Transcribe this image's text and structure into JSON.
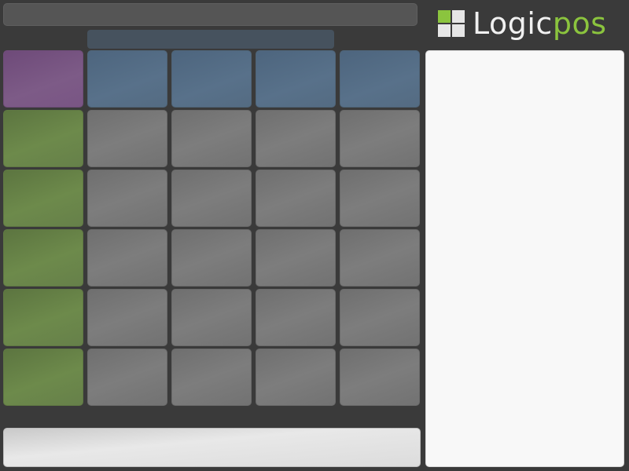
{
  "header": {
    "title": "",
    "subtitle": ""
  },
  "logo": {
    "text_part1": "Logic",
    "text_part2": "pos",
    "mark_icon": "logicpos-logo-icon"
  },
  "colors": {
    "background": "#3a3a3a",
    "accent_green": "#8bc43e",
    "family_tile": "#7d5b87",
    "subfamily_tile": "#58718a",
    "category_tile": "#6d8a4b",
    "article_tile": "#7d7d7d",
    "ticket_panel": "#f8f8f8"
  },
  "grid": {
    "rows": [
      [
        "purple",
        "blue",
        "blue",
        "blue",
        "blue"
      ],
      [
        "green",
        "gray",
        "gray",
        "gray",
        "gray"
      ],
      [
        "green",
        "gray",
        "gray",
        "gray",
        "gray"
      ],
      [
        "green",
        "gray",
        "gray",
        "gray",
        "gray"
      ],
      [
        "green",
        "gray",
        "gray",
        "gray",
        "gray"
      ],
      [
        "green",
        "gray",
        "gray",
        "gray",
        "gray"
      ]
    ]
  },
  "bottom_bar": {
    "text": ""
  },
  "ticket_panel": {
    "text": ""
  }
}
